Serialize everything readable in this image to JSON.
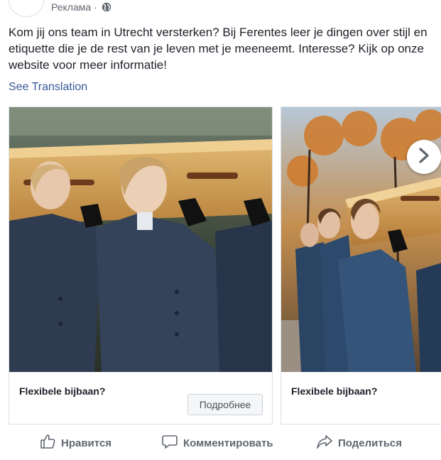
{
  "header": {
    "sponsored_label": "Реклама",
    "separator": "·"
  },
  "post": {
    "text": "Kom jij ons team in Utrecht versterken? Bij Ferentes leer je dingen over stijl en etiquette die je de rest van je leven met je meeneemt. Interesse? Kijk op onze website voor meer informatie!",
    "see_translation": "See Translation"
  },
  "carousel": {
    "cards": [
      {
        "title": "Flexibele bijbaan?",
        "cta": "Подробнее"
      },
      {
        "title": "Flexibele bijbaan?"
      }
    ]
  },
  "actions": {
    "like": "Нравится",
    "comment": "Комментировать",
    "share": "Поделиться"
  },
  "colors": {
    "link": "#385898",
    "muted": "#606770",
    "text": "#1d2129",
    "border": "#dddfe2"
  }
}
